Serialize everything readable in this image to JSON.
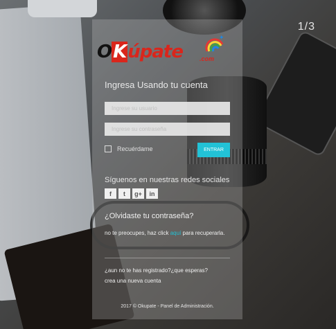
{
  "slider": {
    "counter": "1/3"
  },
  "logo": {
    "o": "O",
    "k": "K",
    "rest": "úpate",
    "domain": ".com"
  },
  "login": {
    "title": "Ingresa Usando tu cuenta",
    "username_placeholder": "Ingrese su usuario",
    "password_placeholder": "Ingrese su contraseña",
    "remember_label": "Recuérdame",
    "enter_button": "ENTRAR"
  },
  "social": {
    "title": "Síguenos en nuestras redes sociales",
    "icons": [
      "f",
      "t",
      "g+",
      "in"
    ]
  },
  "forgot": {
    "title": "¿Olvidaste tu contraseña?",
    "text_before": "no te preocupes, haz click ",
    "link": "aquí",
    "text_after": " para recuperarla."
  },
  "register": {
    "question": "¿aun no te has registrado?¿que esperas?",
    "link": "crea una nueva cuenta"
  },
  "footer": {
    "text": "2017 © Okupate - Panel de Administración."
  },
  "colors": {
    "accent": "#22c2d6",
    "brand_red": "#d9261c"
  }
}
